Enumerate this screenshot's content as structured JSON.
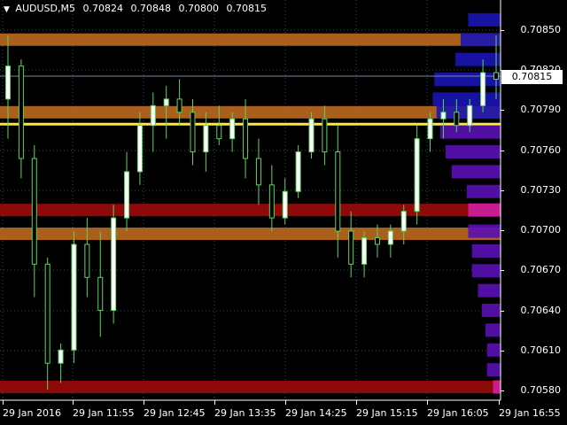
{
  "chart_header": {
    "arrow": "▼",
    "symbol": "AUDUSD,M5",
    "open": "0.70824",
    "high": "0.70848",
    "low": "0.70800",
    "close": "0.70815"
  },
  "price_axis": [
    "0.70850",
    "0.70820",
    "0.70790",
    "0.70760",
    "0.70730",
    "0.70700",
    "0.70670",
    "0.70640",
    "0.70610",
    "0.70580"
  ],
  "current_price_label": "0.70815",
  "time_axis": [
    "29 Jan 2016",
    "29 Jan 11:55",
    "29 Jan 12:45",
    "29 Jan 13:35",
    "29 Jan 14:25",
    "29 Jan 15:15",
    "29 Jan 16:05",
    "29 Jan 16:55"
  ],
  "colors": {
    "background": "#000000",
    "bull_body": "#ffffff",
    "bear_body": "#000000",
    "wick": "#5ed35e",
    "grid": "#3a4a5a",
    "level_orange": "#b4641e",
    "level_red": "#960a0a",
    "level_yellow": "#ffea3a",
    "profile_purple": "#5a10b4",
    "profile_blue": "#1a14b4",
    "profile_poc": "#d21ea0"
  },
  "chart_data": {
    "type": "candlestick",
    "symbol": "AUDUSD",
    "timeframe": "M5",
    "ylim": [
      0.70572,
      0.70875
    ],
    "levels": [
      {
        "price": 0.70845,
        "kind": "resistance-orange"
      },
      {
        "price": 0.7079,
        "kind": "resistance-orange"
      },
      {
        "price": 0.70781,
        "kind": "highlight-yellow"
      },
      {
        "price": 0.70716,
        "kind": "support-red"
      },
      {
        "price": 0.70698,
        "kind": "support-orange"
      },
      {
        "price": 0.70582,
        "kind": "support-red"
      }
    ],
    "candles": [
      {
        "o": 0.708,
        "h": 0.70848,
        "l": 0.7077,
        "c": 0.70825
      },
      {
        "o": 0.70825,
        "h": 0.7083,
        "l": 0.7074,
        "c": 0.70755
      },
      {
        "o": 0.70755,
        "h": 0.70765,
        "l": 0.7065,
        "c": 0.70675
      },
      {
        "o": 0.70675,
        "h": 0.7068,
        "l": 0.7058,
        "c": 0.706
      },
      {
        "o": 0.706,
        "h": 0.70615,
        "l": 0.70585,
        "c": 0.7061
      },
      {
        "o": 0.7061,
        "h": 0.707,
        "l": 0.706,
        "c": 0.7069
      },
      {
        "o": 0.7069,
        "h": 0.7071,
        "l": 0.7065,
        "c": 0.70665
      },
      {
        "o": 0.70665,
        "h": 0.707,
        "l": 0.7062,
        "c": 0.7064
      },
      {
        "o": 0.7064,
        "h": 0.7072,
        "l": 0.7063,
        "c": 0.7071
      },
      {
        "o": 0.7071,
        "h": 0.7076,
        "l": 0.707,
        "c": 0.70745
      },
      {
        "o": 0.70745,
        "h": 0.7079,
        "l": 0.70735,
        "c": 0.7078
      },
      {
        "o": 0.7078,
        "h": 0.70805,
        "l": 0.7076,
        "c": 0.70795
      },
      {
        "o": 0.70795,
        "h": 0.7081,
        "l": 0.7077,
        "c": 0.708
      },
      {
        "o": 0.708,
        "h": 0.70815,
        "l": 0.7078,
        "c": 0.7079
      },
      {
        "o": 0.7079,
        "h": 0.708,
        "l": 0.7075,
        "c": 0.7076
      },
      {
        "o": 0.7076,
        "h": 0.7079,
        "l": 0.70745,
        "c": 0.7078
      },
      {
        "o": 0.7078,
        "h": 0.70795,
        "l": 0.70765,
        "c": 0.7077
      },
      {
        "o": 0.7077,
        "h": 0.7079,
        "l": 0.7076,
        "c": 0.70785
      },
      {
        "o": 0.70785,
        "h": 0.708,
        "l": 0.7074,
        "c": 0.70755
      },
      {
        "o": 0.70755,
        "h": 0.7077,
        "l": 0.7072,
        "c": 0.70735
      },
      {
        "o": 0.70735,
        "h": 0.7075,
        "l": 0.707,
        "c": 0.7071
      },
      {
        "o": 0.7071,
        "h": 0.7074,
        "l": 0.70705,
        "c": 0.7073
      },
      {
        "o": 0.7073,
        "h": 0.70765,
        "l": 0.70725,
        "c": 0.7076
      },
      {
        "o": 0.7076,
        "h": 0.7079,
        "l": 0.70755,
        "c": 0.70785
      },
      {
        "o": 0.70785,
        "h": 0.70795,
        "l": 0.7075,
        "c": 0.7076
      },
      {
        "o": 0.7076,
        "h": 0.7078,
        "l": 0.7068,
        "c": 0.707
      },
      {
        "o": 0.707,
        "h": 0.70715,
        "l": 0.70665,
        "c": 0.70675
      },
      {
        "o": 0.70675,
        "h": 0.707,
        "l": 0.70665,
        "c": 0.70695
      },
      {
        "o": 0.70695,
        "h": 0.70705,
        "l": 0.7068,
        "c": 0.7069
      },
      {
        "o": 0.7069,
        "h": 0.70705,
        "l": 0.7068,
        "c": 0.707
      },
      {
        "o": 0.707,
        "h": 0.7072,
        "l": 0.7069,
        "c": 0.70715
      },
      {
        "o": 0.70715,
        "h": 0.7078,
        "l": 0.70705,
        "c": 0.7077
      },
      {
        "o": 0.7077,
        "h": 0.7079,
        "l": 0.7076,
        "c": 0.70785
      },
      {
        "o": 0.70785,
        "h": 0.708,
        "l": 0.7077,
        "c": 0.7079
      },
      {
        "o": 0.7079,
        "h": 0.708,
        "l": 0.70775,
        "c": 0.7078
      },
      {
        "o": 0.7078,
        "h": 0.708,
        "l": 0.70775,
        "c": 0.70795
      },
      {
        "o": 0.70795,
        "h": 0.7083,
        "l": 0.7079,
        "c": 0.7082
      },
      {
        "o": 0.7082,
        "h": 0.70848,
        "l": 0.708,
        "c": 0.70815
      }
    ],
    "volume_profile": [
      {
        "price": 0.7086,
        "width": 0.43
      },
      {
        "price": 0.70845,
        "width": 0.53
      },
      {
        "price": 0.7083,
        "width": 0.6
      },
      {
        "price": 0.70815,
        "width": 0.88
      },
      {
        "price": 0.708,
        "width": 0.9
      },
      {
        "price": 0.7079,
        "width": 0.85
      },
      {
        "price": 0.70775,
        "width": 0.8
      },
      {
        "price": 0.7076,
        "width": 0.73
      },
      {
        "price": 0.70745,
        "width": 0.65
      },
      {
        "price": 0.7073,
        "width": 0.45
      },
      {
        "price": 0.70716,
        "width": 0.43,
        "poc": true
      },
      {
        "price": 0.707,
        "width": 0.43
      },
      {
        "price": 0.70685,
        "width": 0.38
      },
      {
        "price": 0.7067,
        "width": 0.38
      },
      {
        "price": 0.70655,
        "width": 0.3
      },
      {
        "price": 0.7064,
        "width": 0.25
      },
      {
        "price": 0.70625,
        "width": 0.2
      },
      {
        "price": 0.7061,
        "width": 0.18
      },
      {
        "price": 0.70595,
        "width": 0.18
      },
      {
        "price": 0.70582,
        "width": 0.1,
        "poc": true
      }
    ]
  }
}
